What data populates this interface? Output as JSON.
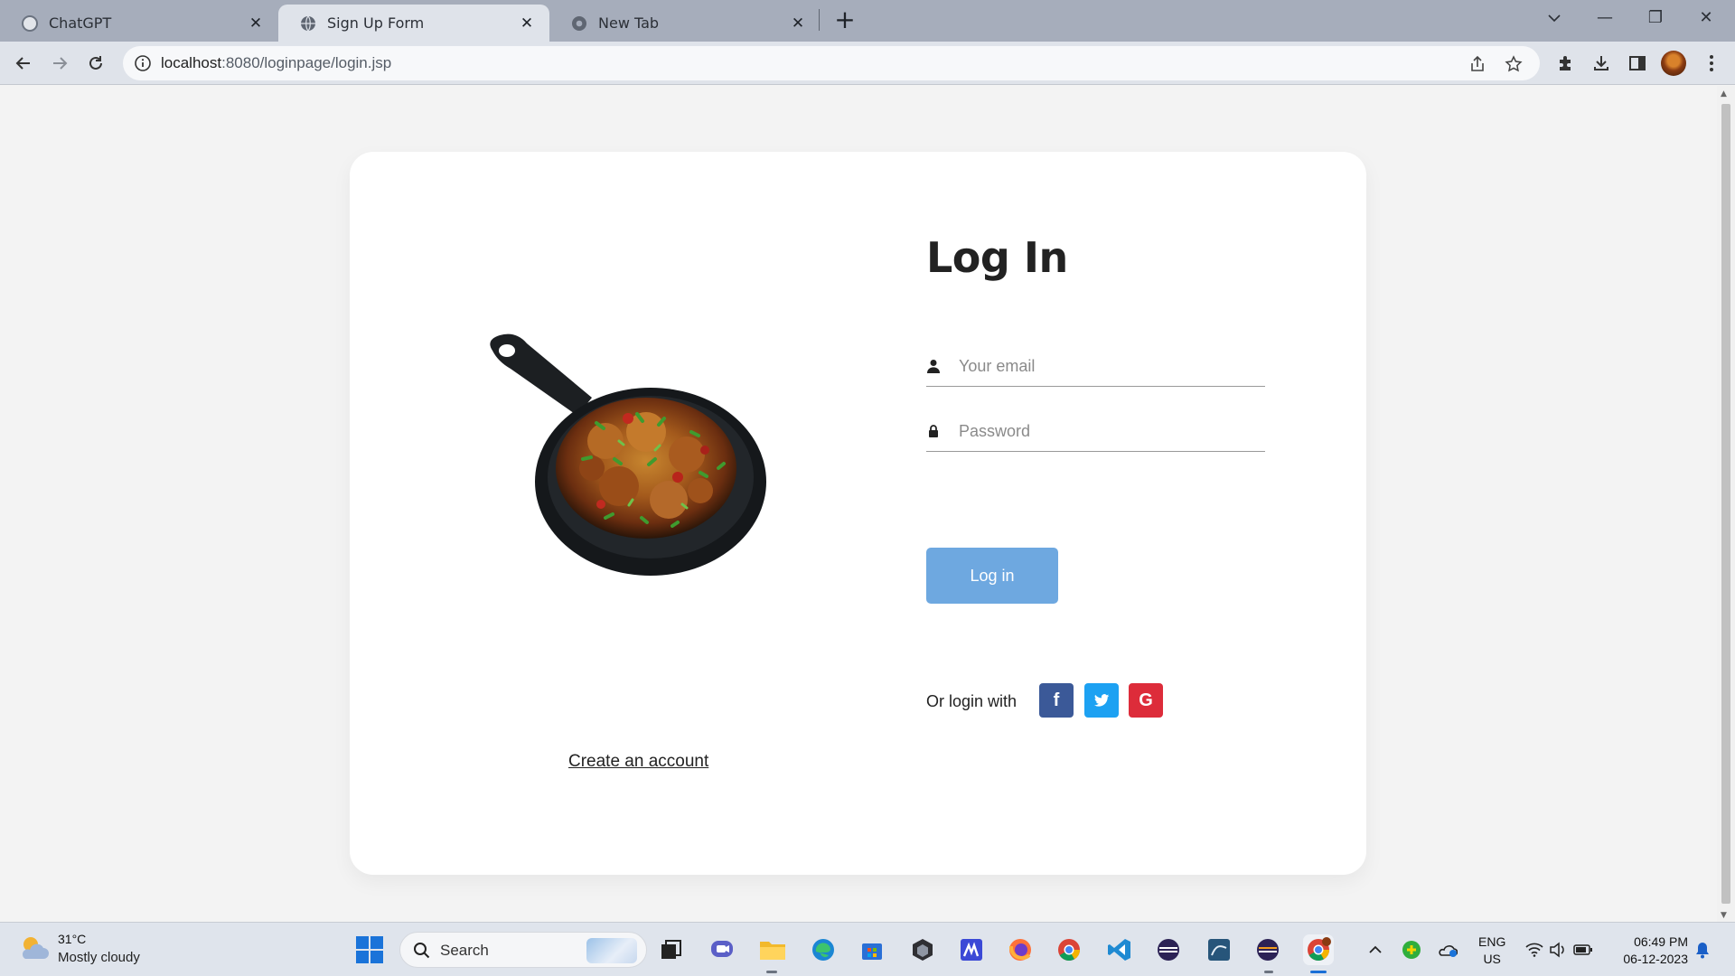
{
  "browser": {
    "tabs": [
      {
        "label": "ChatGPT"
      },
      {
        "label": "Sign Up Form"
      },
      {
        "label": "New Tab"
      }
    ],
    "url_host": "localhost",
    "url_path": ":8080/loginpage/login.jsp"
  },
  "page": {
    "title": "Log In",
    "email_placeholder": "Your email",
    "password_placeholder": "Password",
    "login_button": "Log in",
    "or_login_with": "Or login with",
    "social": {
      "facebook": "f",
      "google": "G"
    },
    "create_account": "Create an account"
  },
  "taskbar": {
    "weather_temp": "31°C",
    "weather_desc": "Mostly cloudy",
    "search_label": "Search",
    "lang_line1": "ENG",
    "lang_line2": "US",
    "time": "06:49 PM",
    "date": "06-12-2023"
  },
  "colors": {
    "login_button": "#6ea8e0",
    "facebook": "#3b5998",
    "twitter": "#1da1f2",
    "google": "#dd2c3a"
  }
}
